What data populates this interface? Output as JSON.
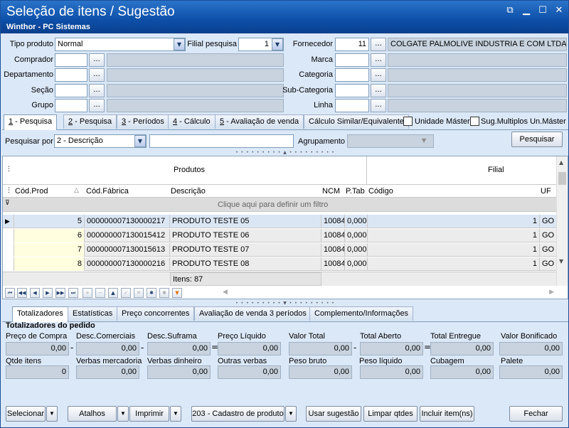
{
  "window": {
    "title": "Seleção de itens / Sugestão",
    "subtitle": "Winthor - PC Sistemas"
  },
  "filters": {
    "tipo_produto_label": "Tipo produto",
    "tipo_produto_value": "Normal",
    "filial_label": "Filial pesquisa",
    "filial_value": "1",
    "fornecedor_label": "Fornecedor",
    "fornecedor_code": "11",
    "fornecedor_name": "COLGATE PALMOLIVE INDUSTRIA  E COM LTDA",
    "comprador_label": "Comprador",
    "marca_label": "Marca",
    "departamento_label": "Departamento",
    "categoria_label": "Categoria",
    "secao_label": "Seção",
    "subcategoria_label": "Sub-Categoria",
    "grupo_label": "Grupo",
    "linha_label": "Linha",
    "dots": "..."
  },
  "tabs": [
    {
      "num": "1",
      "label": " - Pesquisa"
    },
    {
      "num": "2",
      "label": " - Pesquisa"
    },
    {
      "num": "3",
      "label": " - Períodos"
    },
    {
      "num": "4",
      "label": " - Cálculo"
    },
    {
      "num": "5",
      "label": " - Avaliação de venda"
    },
    {
      "num": "",
      "label": "Cálculo Similar/Equivalente"
    }
  ],
  "checks": {
    "unidade_master": "Unidade Máster",
    "sug_multiplos": "Sug.Multiplos Un.Máster"
  },
  "search": {
    "label": "Pesquisar por",
    "value": "2 - Descrição",
    "agrupamento_label": "Agrupamento",
    "button": "Pesquisar"
  },
  "grid": {
    "band_produtos": "Produtos",
    "band_filial": "Filial",
    "columns": [
      "Cód.Prod",
      "Cód.Fábrica",
      "Descrição",
      "NCM",
      "P.Tab",
      "Código",
      "UF"
    ],
    "filter_hint": "Clique aqui para definir um filtro",
    "rows": [
      {
        "cod": "5",
        "fab": "000000007130000217",
        "desc": "PRODUTO TESTE 05",
        "ncm": "10084",
        "ptab": "0,000",
        "codigo": "1",
        "uf": "GO"
      },
      {
        "cod": "6",
        "fab": "000000007130015412",
        "desc": "PRODUTO TESTE 06",
        "ncm": "10084",
        "ptab": "0,000",
        "codigo": "1",
        "uf": "GO"
      },
      {
        "cod": "7",
        "fab": "000000007130015613",
        "desc": "PRODUTO TESTE 07",
        "ncm": "10084",
        "ptab": "0,000",
        "codigo": "1",
        "uf": "GO"
      },
      {
        "cod": "8",
        "fab": "000000007130000216",
        "desc": "PRODUTO TESTE 08",
        "ncm": "10084",
        "ptab": "0,000",
        "codigo": "1",
        "uf": "GO"
      }
    ],
    "footer": "Itens: 87"
  },
  "bottom_tabs": [
    "Totalizadores",
    "Estatísticas",
    "Preço concorrentes",
    "Avaliação de venda 3 períodos",
    "Complemento/Informações"
  ],
  "totals": {
    "title": "Totalizadores do pedido",
    "row1": [
      {
        "label": "Preço de Compra",
        "value": "0,00"
      },
      {
        "label": "Desc.Comerciais",
        "value": "0,00"
      },
      {
        "label": "Desc.Suframa",
        "value": "0,00"
      },
      {
        "label": "Preço Líquido",
        "value": "0,00"
      },
      {
        "label": "Valor Total",
        "value": "0,00"
      },
      {
        "label": "Total Aberto",
        "value": "0,00"
      },
      {
        "label": "Total Entregue",
        "value": "0,00"
      },
      {
        "label": "Valor Bonificado",
        "value": "0,00"
      }
    ],
    "row2": [
      {
        "label": "Qtde itens",
        "value": "0"
      },
      {
        "label": "Verbas mercadoria",
        "value": "0,00"
      },
      {
        "label": "Verbas dinheiro",
        "value": "0,00"
      },
      {
        "label": "Outras verbas",
        "value": "0,00"
      },
      {
        "label": "Peso bruto",
        "value": "0,00"
      },
      {
        "label": "Peso líquido",
        "value": "0,00"
      },
      {
        "label": "Cubagem",
        "value": "0,00"
      },
      {
        "label": "Palete",
        "value": "0,00"
      }
    ]
  },
  "footer_buttons": {
    "selecionar": "Selecionar",
    "atalhos": "Atalhos",
    "imprimir": "Imprimir",
    "rotina": "203 - Cadastro de produto",
    "usar_sugestao": "Usar sugestão",
    "limpar_qtdes": "Limpar qtdes",
    "incluir": "Incluir item(ns)",
    "fechar": "Fechar"
  }
}
